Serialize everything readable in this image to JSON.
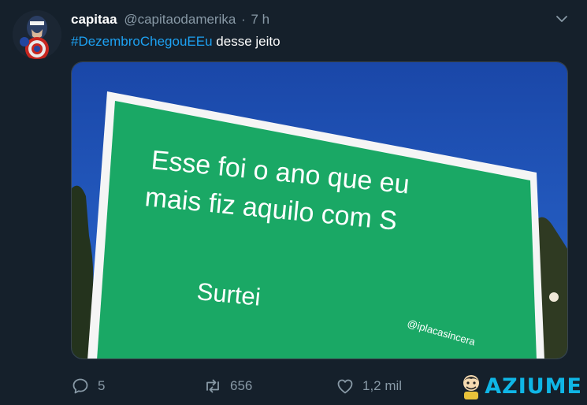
{
  "tweet": {
    "display_name": "capitaa",
    "handle": "@capitaodamerika",
    "separator": "·",
    "time": "7 h",
    "hashtag": "#DezembroChegouEEu",
    "text": " desse jeito",
    "avatar_icon": "captain-america-avatar",
    "more_icon": "chevron-down-icon"
  },
  "media": {
    "sign_lines": [
      "Esse foi o ano que eu",
      "mais fiz aquilo com S"
    ],
    "sign_sub": "Surtei",
    "sign_watermark": "@iplacasincera",
    "sign_color": "#1aa865",
    "sky_color": "#1f52b8"
  },
  "actions": {
    "reply_count": "5",
    "retweet_count": "656",
    "like_count": "1,2 mil",
    "reply_icon": "reply-icon",
    "retweet_icon": "retweet-icon",
    "like_icon": "heart-icon"
  },
  "watermark": {
    "text": "AZIUME",
    "accent": "#0fb6e6"
  },
  "colors": {
    "background": "#15202b",
    "text": "#ffffff",
    "muted": "#8899a6",
    "link": "#1da1f2"
  }
}
